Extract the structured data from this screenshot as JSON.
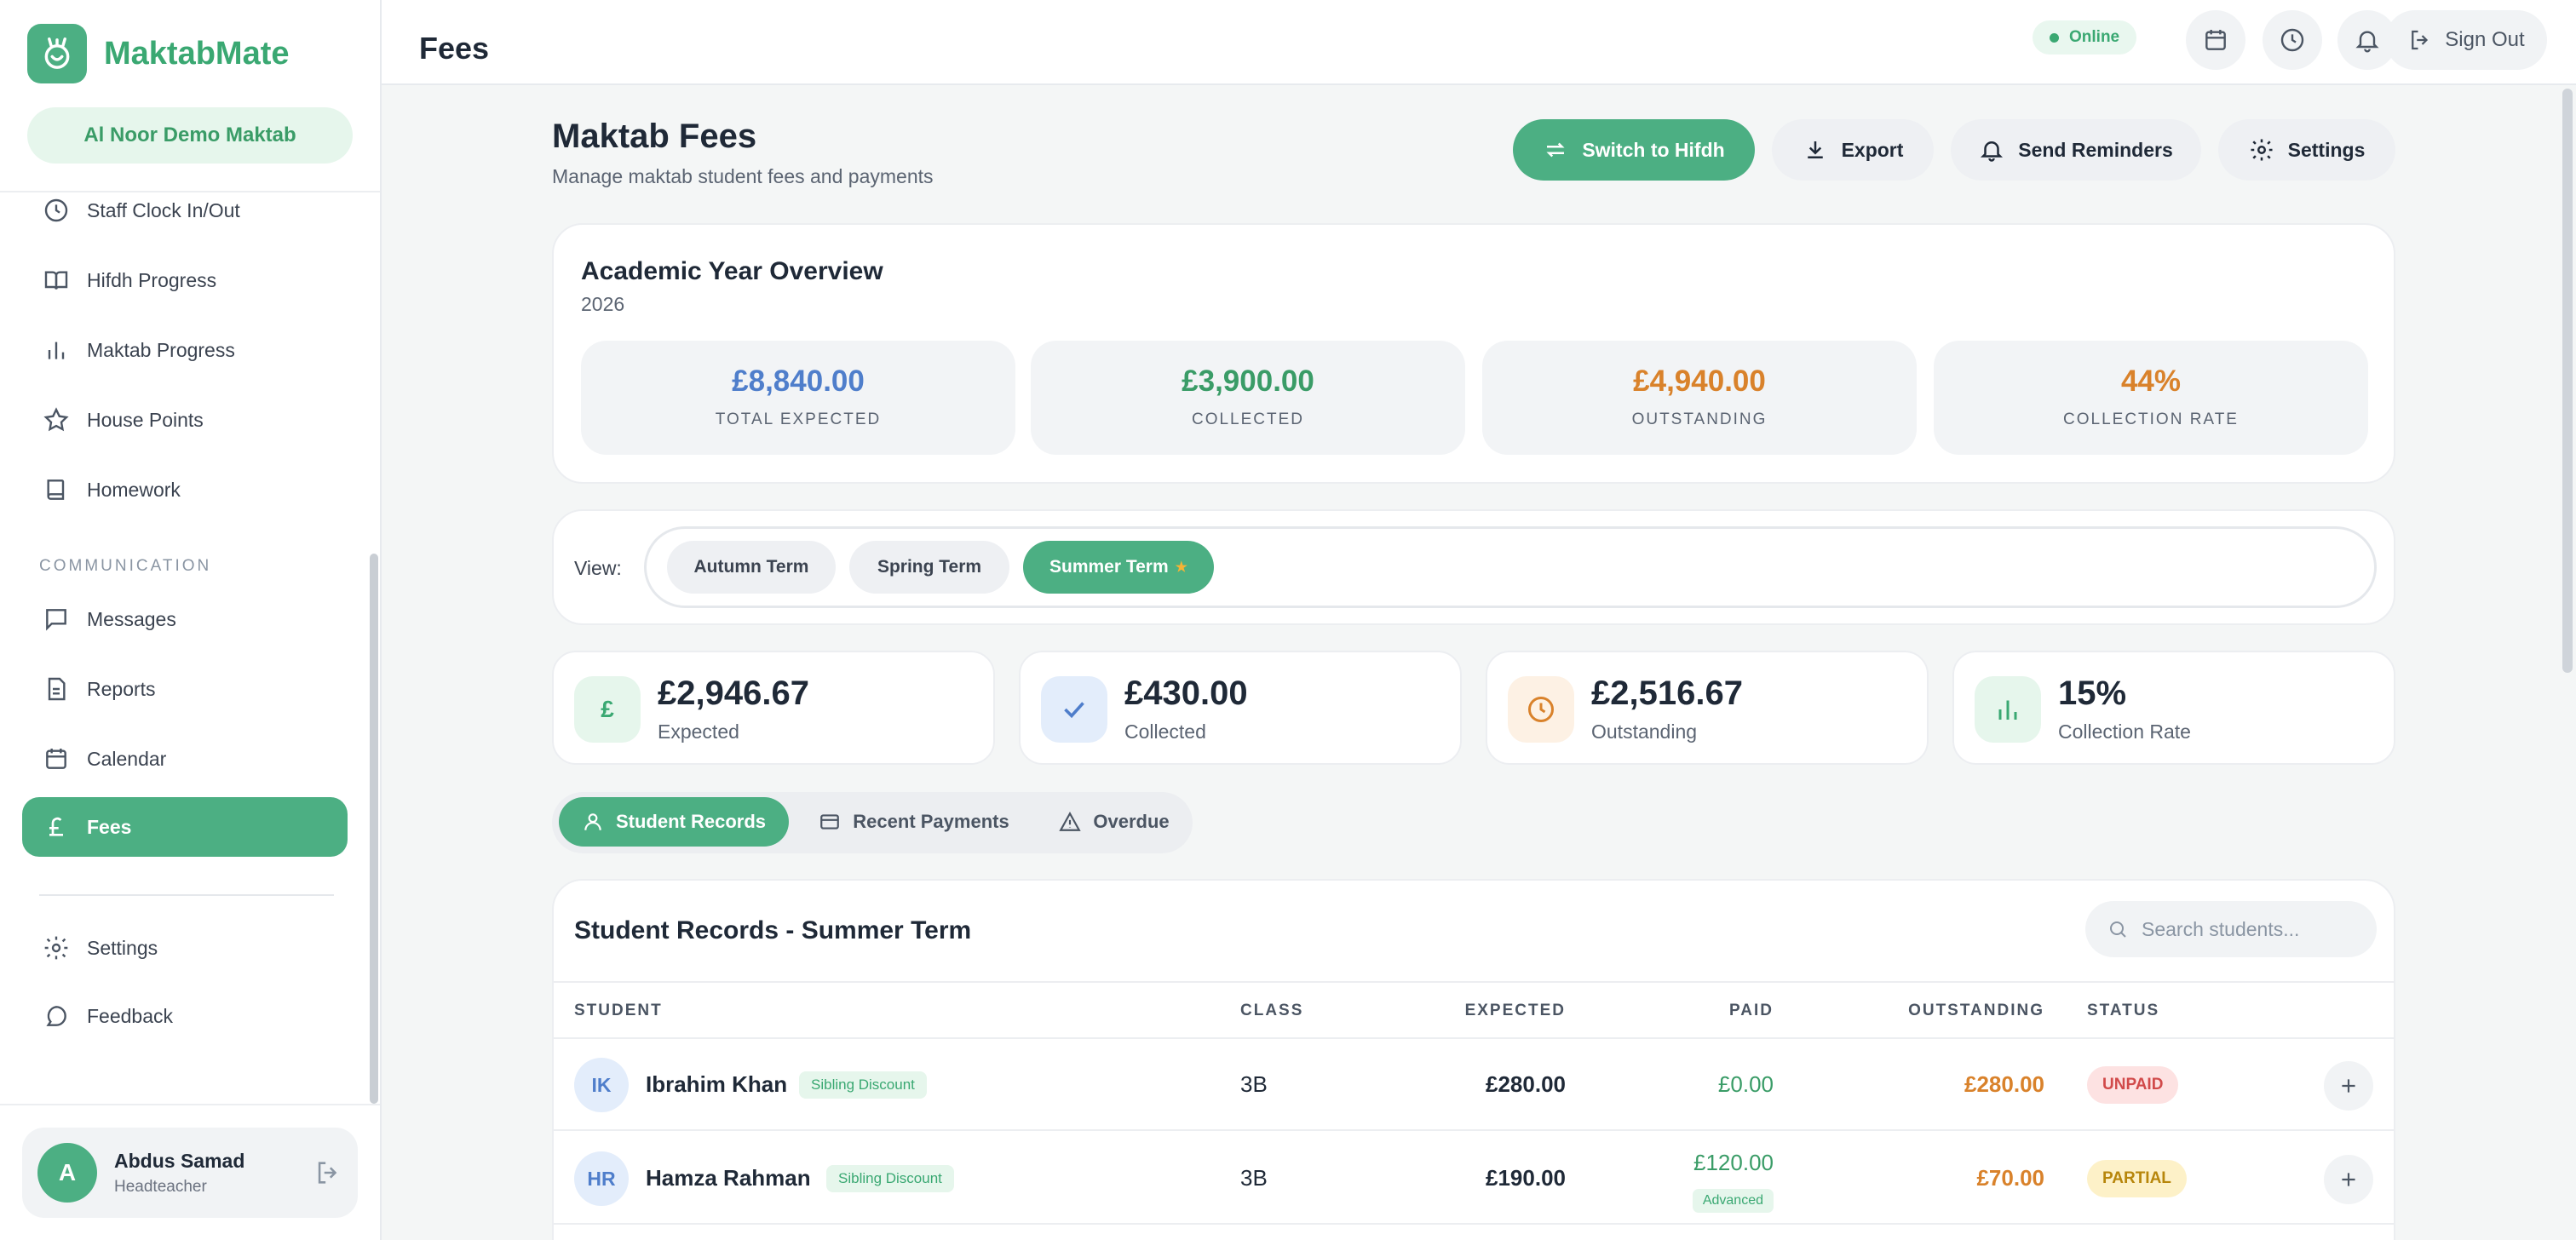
{
  "app": {
    "name": "MaktabMate",
    "school": "Al Noor Demo Maktab",
    "page_title": "Fees"
  },
  "sidebar": {
    "items": [
      {
        "label": "Staff Clock In/Out",
        "icon": "clock-icon"
      },
      {
        "label": "Hifdh Progress",
        "icon": "book-open-icon"
      },
      {
        "label": "Maktab Progress",
        "icon": "bar-chart-icon"
      },
      {
        "label": "House Points",
        "icon": "star-icon"
      },
      {
        "label": "Homework",
        "icon": "book-icon"
      }
    ],
    "section_communication": "COMMUNICATION",
    "communication_items": [
      {
        "label": "Messages",
        "icon": "message-icon"
      },
      {
        "label": "Reports",
        "icon": "file-icon"
      },
      {
        "label": "Calendar",
        "icon": "calendar-icon"
      },
      {
        "label": "Fees",
        "icon": "pound-icon",
        "active": true
      }
    ],
    "bottom_items": [
      {
        "label": "Settings",
        "icon": "gear-icon"
      },
      {
        "label": "Feedback",
        "icon": "chat-icon"
      }
    ],
    "user": {
      "initial": "A",
      "name": "Abdus Samad",
      "role": "Headteacher"
    }
  },
  "topbar": {
    "status": "Online",
    "sign_out": "Sign Out"
  },
  "header": {
    "title": "Maktab Fees",
    "subtitle": "Manage maktab student fees and payments",
    "buttons": {
      "switch": "Switch to Hifdh",
      "export": "Export",
      "reminders": "Send Reminders",
      "settings": "Settings"
    }
  },
  "overview": {
    "title": "Academic Year Overview",
    "year": "2026",
    "stats": [
      {
        "value": "£8,840.00",
        "label": "TOTAL EXPECTED",
        "color": "#4f7ecb"
      },
      {
        "value": "£3,900.00",
        "label": "COLLECTED",
        "color": "#3a9c67"
      },
      {
        "value": "£4,940.00",
        "label": "OUTSTANDING",
        "color": "#d9822b"
      },
      {
        "value": "44%",
        "label": "COLLECTION RATE",
        "color": "#d9822b"
      }
    ]
  },
  "view": {
    "label": "View:",
    "terms": [
      "Autumn Term",
      "Spring Term",
      "Summer Term"
    ],
    "active_term": "Summer Term",
    "current_marker": "★"
  },
  "term_stats": [
    {
      "icon_text": "£",
      "value": "£2,946.67",
      "label": "Expected"
    },
    {
      "value": "£430.00",
      "label": "Collected"
    },
    {
      "value": "£2,516.67",
      "label": "Outstanding"
    },
    {
      "value": "15%",
      "label": "Collection Rate"
    }
  ],
  "tabs": [
    "Student Records",
    "Recent Payments",
    "Overdue"
  ],
  "records": {
    "title": "Student Records - Summer Term",
    "search_placeholder": "Search students...",
    "columns": [
      "STUDENT",
      "CLASS",
      "EXPECTED",
      "PAID",
      "OUTSTANDING",
      "STATUS"
    ],
    "rows": [
      {
        "initials": "IK",
        "name": "Ibrahim Khan",
        "badge": "Sibling Discount",
        "class": "3B",
        "expected": "£280.00",
        "paid": "£0.00",
        "paid_note": "",
        "outstanding": "£280.00",
        "status": "UNPAID"
      },
      {
        "initials": "HR",
        "name": "Hamza Rahman",
        "badge": "Sibling Discount",
        "class": "3B",
        "expected": "£190.00",
        "paid": "£120.00",
        "paid_note": "Advanced",
        "outstanding": "£70.00",
        "status": "PARTIAL"
      }
    ]
  }
}
